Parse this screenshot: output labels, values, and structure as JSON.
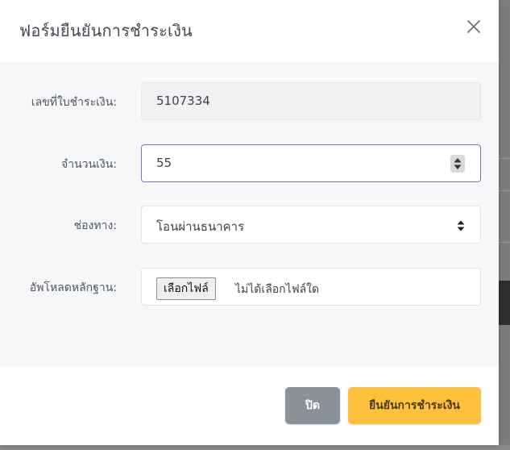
{
  "modal": {
    "title": "ฟอร์มยืนยันการชำระเงิน",
    "close_icon": "close-icon"
  },
  "form": {
    "invoice_number": {
      "label": "เลขที่ใบชำระเงิน:",
      "value": "5107334"
    },
    "amount": {
      "label": "จำนวนเงิน:",
      "value": "55"
    },
    "channel": {
      "label": "ช่องทาง:",
      "selected": "โอนผ่านธนาคาร"
    },
    "upload": {
      "label": "อัพโหลดหลักฐาน:",
      "button_label": "เลือกไฟล์",
      "status_text": "ไม่ได้เลือกไฟล์ใด"
    }
  },
  "footer": {
    "close_label": "ปิด",
    "confirm_label": "ยืนยันการชำระเงิน"
  },
  "colors": {
    "confirm_button": "#ffc13d",
    "close_button": "#8a9299",
    "focus_border": "#8a6bb0"
  }
}
